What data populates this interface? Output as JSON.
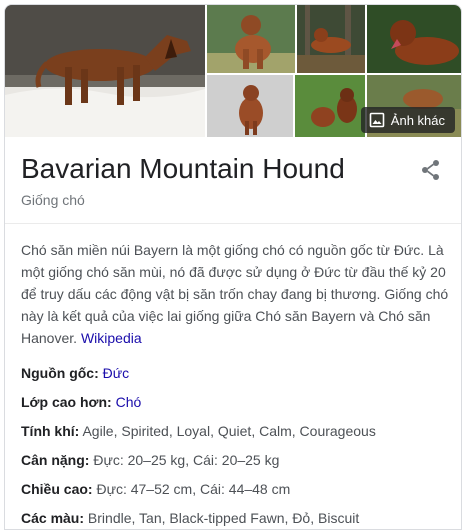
{
  "gallery": {
    "more_images_label": "Ảnh khác"
  },
  "header": {
    "title": "Bavarian Mountain Hound",
    "subtitle": "Giống chó"
  },
  "description": {
    "text": "Chó săn miền núi Bayern là một giống chó có nguồn gốc từ Đức. Là một giống chó săn mùi, nó đã được sử dụng ở Đức từ đầu thế kỷ 20 để truy dấu các động vật bị săn trốn chay đang bị thương. Giống chó này là kết quả của việc lai giống giữa Chó săn Bayern và Chó săn Hanover.",
    "source_link": "Wikipedia"
  },
  "facts": [
    {
      "label": "Nguồn gốc:",
      "value": "Đức",
      "is_link": true
    },
    {
      "label": "Lớp cao hơn:",
      "value": "Chó",
      "is_link": true
    },
    {
      "label": "Tính khí:",
      "value": "Agile, Spirited, Loyal, Quiet, Calm, Courageous",
      "is_link": false
    },
    {
      "label": "Cân nặng:",
      "value": "Đực: 20–25 kg, Cái: 20–25 kg",
      "is_link": false
    },
    {
      "label": "Chiều cao:",
      "value": "Đực: 47–52 cm, Cái: 44–48 cm",
      "is_link": false
    },
    {
      "label": "Các màu:",
      "value": "Brindle, Tan, Black-tipped Fawn, Đỏ, Biscuit",
      "is_link": false
    }
  ],
  "colors": {
    "link": "#1a0dab",
    "title": "#202124",
    "muted": "#70757a",
    "body": "#4d5156"
  },
  "icons": {
    "share": "share-icon",
    "more_images": "image-icon"
  }
}
